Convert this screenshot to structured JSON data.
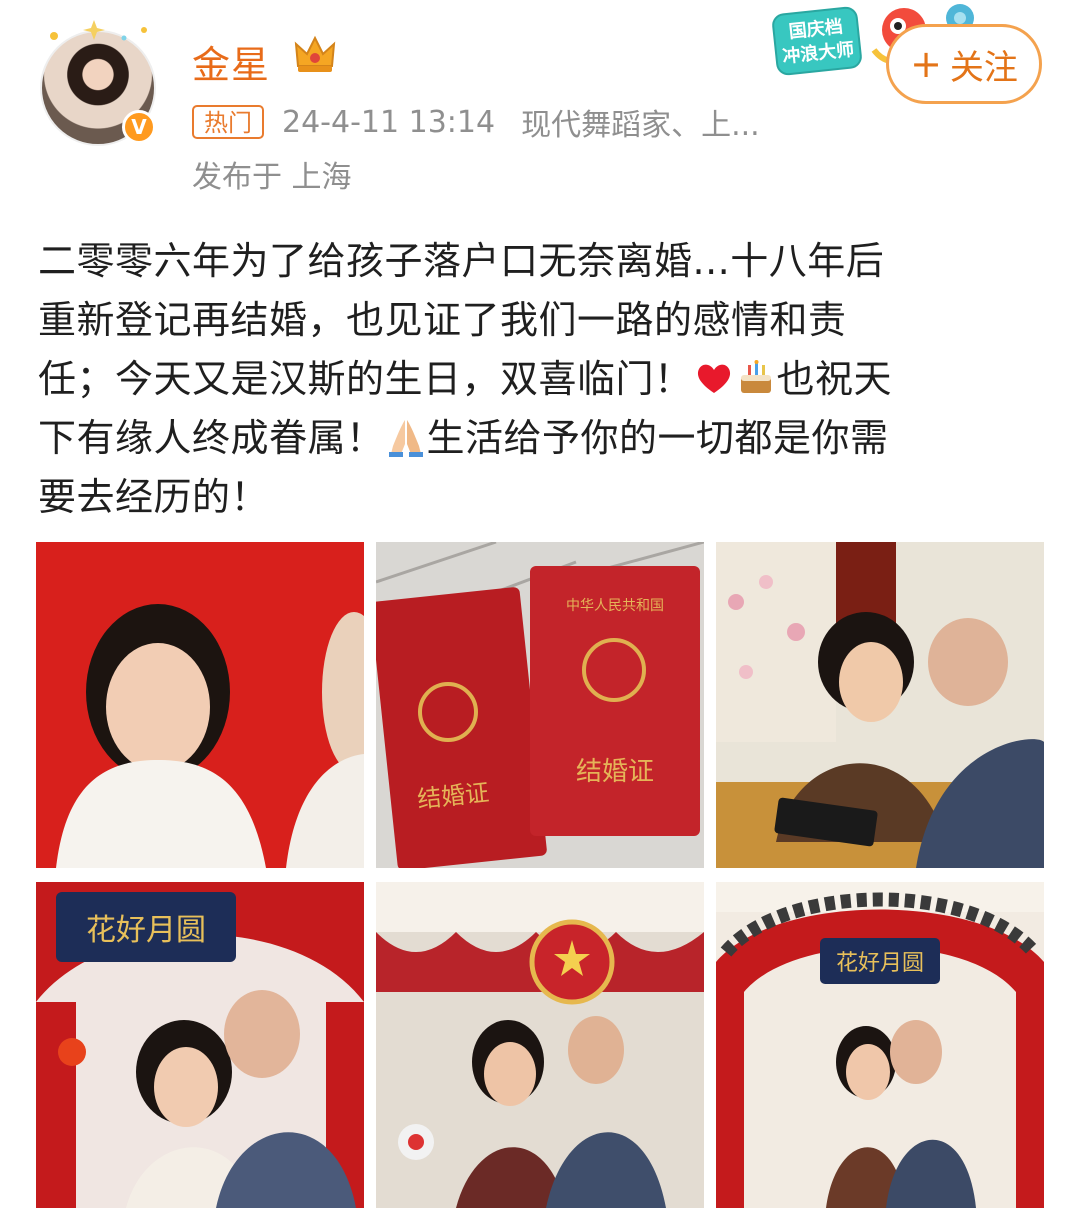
{
  "user": {
    "name": "金星",
    "avatar_icon": "user-avatar",
    "verified_icon": "verified-v-icon",
    "crown_icon": "crown-icon"
  },
  "meta": {
    "hot_label": "热门",
    "timestamp": "24-4-11 13:14",
    "source": "现代舞蹈家、上...",
    "location": "发布于 上海"
  },
  "promo": {
    "line1": "国庆档",
    "line2": "冲浪大师"
  },
  "follow": {
    "plus": "+",
    "label": "关注"
  },
  "post": {
    "line1": "二零零六年为了给孩子落户口无奈离婚...十八年后",
    "line2": "重新登记再结婚，也见证了我们一路的感情和责",
    "line3_a": "任；今天又是汉斯的生日，双喜临门！",
    "line3_b": "也祝天",
    "line4_a": "下有缘人终成眷属！",
    "line4_b": "生活给予你的一切都是你需",
    "line5": "要去经历的！"
  },
  "emojis": [
    "heart-icon",
    "birthday-cake-icon",
    "praying-hands-icon"
  ],
  "photos": {
    "certificate_title": "结婚证",
    "certificate_header": "中华人民共和国",
    "arch_sign": "花好月圆"
  },
  "colors": {
    "accent_orange": "#e86b19",
    "meta_gray": "#8f8f8f",
    "hot_badge": "#e97b2e"
  }
}
